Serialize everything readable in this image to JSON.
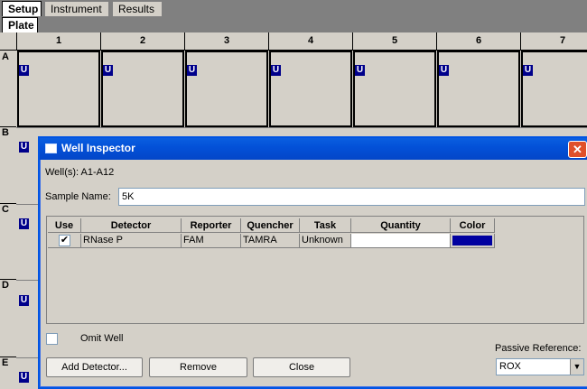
{
  "tabs": [
    "Setup",
    "Instrument",
    "Results"
  ],
  "subtab": "Plate",
  "plate": {
    "columns": [
      "1",
      "2",
      "3",
      "4",
      "5",
      "6",
      "7"
    ],
    "rows": [
      "A",
      "B",
      "C",
      "D",
      "E"
    ],
    "well_badge": "U"
  },
  "dialog": {
    "title": "Well Inspector",
    "wells": "Well(s): A1-A12",
    "sample_label": "Sample Name:",
    "sample_value": "5K",
    "table": {
      "headers": [
        "Use",
        "Detector",
        "Reporter",
        "Quencher",
        "Task",
        "Quantity",
        "Color"
      ],
      "rows": [
        {
          "use": true,
          "detector": "RNase P",
          "reporter": "FAM",
          "quencher": "TAMRA",
          "task": "Unknown",
          "quantity": "",
          "color": "#0000a0"
        }
      ]
    },
    "omit_well_label": "Omit Well",
    "passive_reference_label": "Passive Reference:",
    "passive_reference_value": "ROX",
    "buttons": {
      "add_detector": "Add Detector...",
      "remove": "Remove",
      "close": "Close"
    }
  }
}
